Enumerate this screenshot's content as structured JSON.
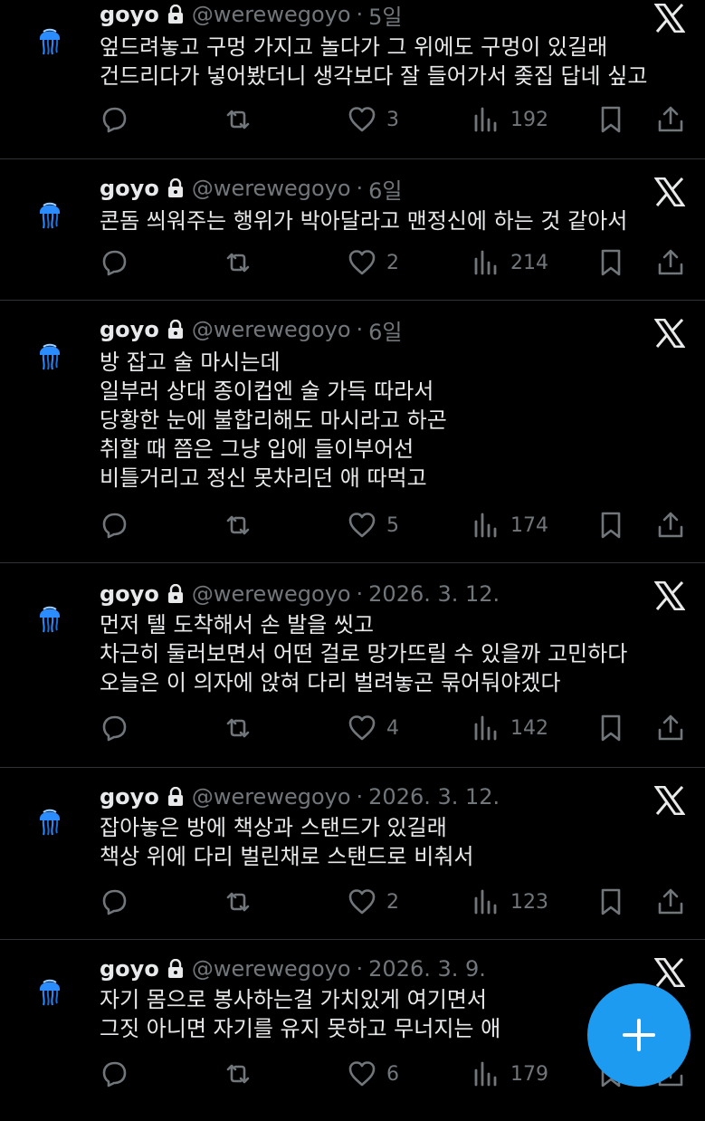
{
  "tweets": [
    {
      "name": "goyo",
      "handle": "@werewegoyo",
      "separator": "·",
      "time": "5일",
      "text": "엎드려놓고 구멍 가지고 놀다가 그 위에도 구멍이 있길래\n건드리다가 넣어봤더니 생각보다 잘 들어가서 좆집 답네 싶고",
      "replies": "",
      "reposts": "",
      "likes": "3",
      "views": "192"
    },
    {
      "name": "goyo",
      "handle": "@werewegoyo",
      "separator": "·",
      "time": "6일",
      "text": "콘돔 씌워주는 행위가 박아달라고 맨정신에 하는 것 같아서",
      "replies": "",
      "reposts": "",
      "likes": "2",
      "views": "214"
    },
    {
      "name": "goyo",
      "handle": "@werewegoyo",
      "separator": "·",
      "time": "6일",
      "text": "방 잡고 술 마시는데\n일부러 상대 종이컵엔 술 가득 따라서\n당황한 눈에 불합리해도 마시라고 하곤\n취할 때 쯤은 그냥 입에 들이부어선\n비틀거리고 정신 못차리던 애 따먹고",
      "replies": "",
      "reposts": "",
      "likes": "5",
      "views": "174"
    },
    {
      "name": "goyo",
      "handle": "@werewegoyo",
      "separator": "·",
      "time": "2026. 3. 12.",
      "text": "먼저 텔 도착해서 손 발을 씻고\n차근히 둘러보면서 어떤 걸로 망가뜨릴 수 있을까 고민하다\n오늘은 이 의자에 앉혀 다리 벌려놓곤 묶어둬야겠다",
      "replies": "",
      "reposts": "",
      "likes": "4",
      "views": "142"
    },
    {
      "name": "goyo",
      "handle": "@werewegoyo",
      "separator": "·",
      "time": "2026. 3. 12.",
      "text": "잡아놓은 방에 책상과 스탠드가 있길래\n책상 위에 다리 벌린채로 스탠드로 비춰서",
      "replies": "",
      "reposts": "",
      "likes": "2",
      "views": "123"
    },
    {
      "name": "goyo",
      "handle": "@werewegoyo",
      "separator": "·",
      "time": "2026. 3. 9.",
      "text": "자기 몸으로 봉사하는걸 가치있게 여기면서\n그짓 아니면 자기를 유지 못하고 무너지는 애",
      "replies": "",
      "reposts": "",
      "likes": "6",
      "views": "179"
    }
  ],
  "icons": {
    "avatar": "jellyfish-icon",
    "lock": "lock-icon",
    "x_logo": "x-logo-icon",
    "reply": "reply-icon",
    "repost": "repost-icon",
    "like": "heart-icon",
    "views": "views-icon",
    "bookmark": "bookmark-icon",
    "share": "share-icon",
    "compose": "plus-icon"
  },
  "colors": {
    "background": "#000000",
    "text": "#e7e9ea",
    "muted": "#71767b",
    "divider": "#2f3336",
    "accent": "#1d9bf0"
  }
}
